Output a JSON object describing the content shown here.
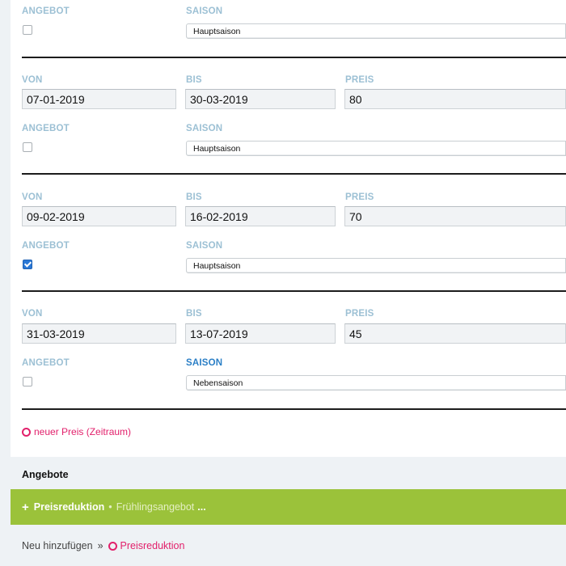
{
  "labels": {
    "von": "VON",
    "bis": "BIS",
    "preis": "PREIS",
    "angebot": "ANGEBOT",
    "saison": "SAISON"
  },
  "periods": [
    {
      "angebot": false,
      "saison": "Hauptsaison"
    },
    {
      "von": "07-01-2019",
      "bis": "30-03-2019",
      "preis": "80",
      "angebot": false,
      "saison": "Hauptsaison"
    },
    {
      "von": "09-02-2019",
      "bis": "16-02-2019",
      "preis": "70",
      "angebot": true,
      "saison": "Hauptsaison"
    },
    {
      "von": "31-03-2019",
      "bis": "13-07-2019",
      "preis": "45",
      "angebot": false,
      "saison": "Nebensaison"
    }
  ],
  "add_price_link": "neuer Preis (Zeitraum)",
  "offers": {
    "heading": "Angebote",
    "item": {
      "plus_icon": "+",
      "title": "Preisreduktion",
      "separator": "•",
      "subtitle": "Frühlingsangebot",
      "more": "..."
    },
    "add_new": {
      "label": "Neu hinzufügen",
      "separator": "»",
      "link": "Preisreduktion"
    }
  },
  "colors": {
    "label": "#9cc0d4",
    "label_active": "#2b7fc6",
    "link_pink": "#e2206b",
    "offer_green": "#9bc23a",
    "checkbox_checked": "#2a78d6"
  },
  "icons": {
    "add_link": "circle-icon",
    "offer_expand": "plus-icon"
  }
}
